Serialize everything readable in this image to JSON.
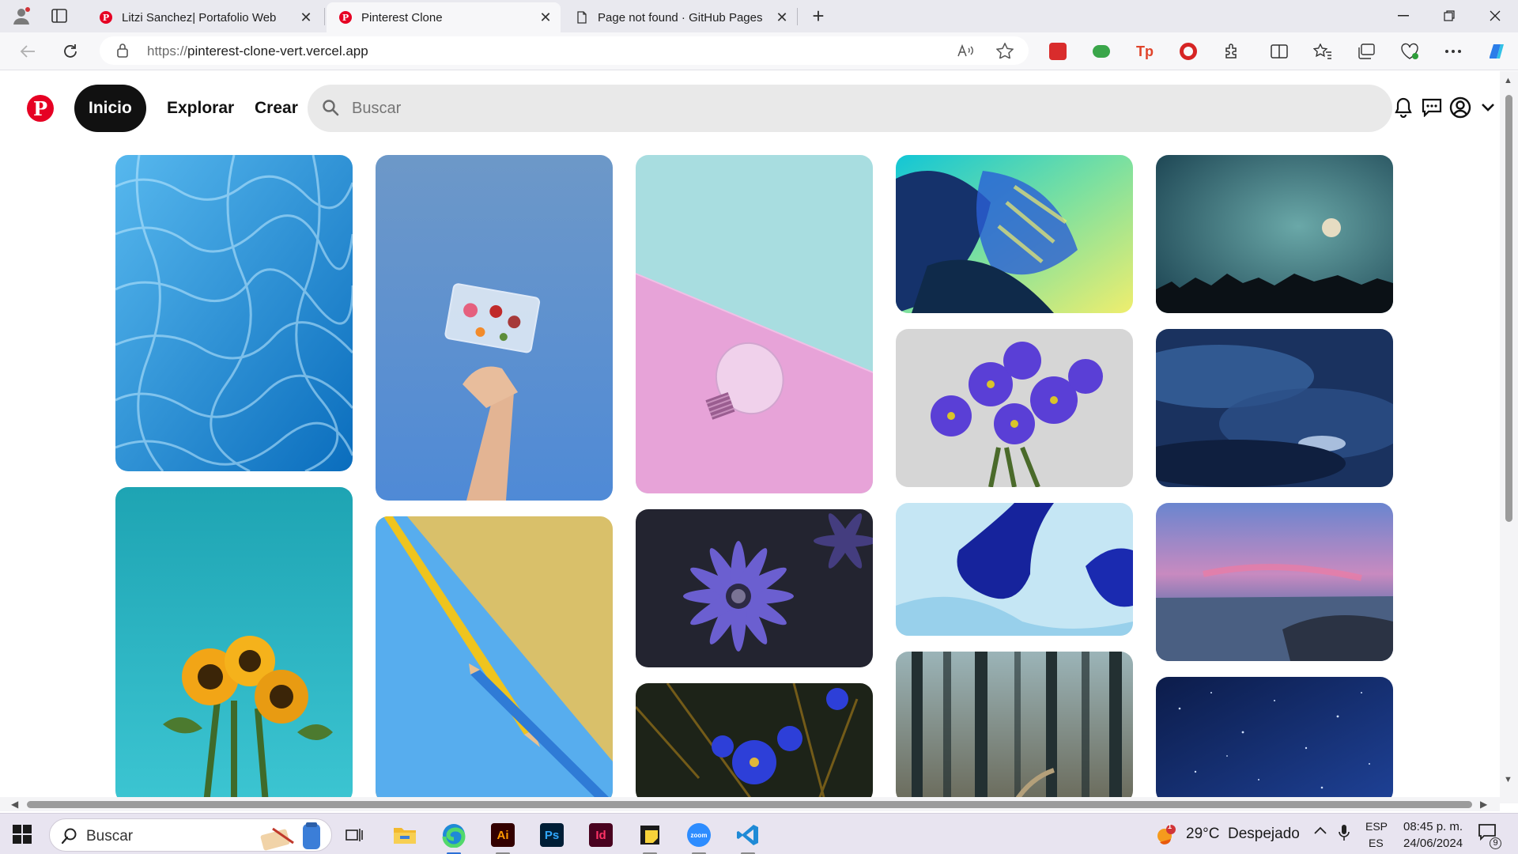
{
  "browser": {
    "tabs": [
      {
        "title": "Litzi Sanchez| Portafolio Web",
        "active": false
      },
      {
        "title": "Pinterest Clone",
        "active": true
      },
      {
        "title": "Page not found · GitHub Pages",
        "active": false
      }
    ],
    "tab_close_glyph": "✕",
    "new_tab_glyph": "+",
    "url_scheme": "https://",
    "url_host": "pinterest-clone-vert.vercel.app"
  },
  "header": {
    "logo_letter": "P",
    "nav": {
      "home": "Inicio",
      "explore": "Explorar",
      "create": "Crear"
    },
    "search_placeholder": "Buscar"
  },
  "pins": [
    {
      "desc": "swimming pool water",
      "colors": [
        "#3fa8e6",
        "#0b74c4"
      ]
    },
    {
      "desc": "sunflowers on teal",
      "colors": [
        "#2fb3c1",
        "#1a9fb0"
      ]
    },
    {
      "desc": "hand holding cassette",
      "colors": [
        "#6f9ccf",
        "#5b8fd0"
      ]
    },
    {
      "desc": "pencils on yellow and blue",
      "colors": [
        "#d9c06a",
        "#55aef0"
      ]
    },
    {
      "desc": "light bulb pink and teal",
      "colors": [
        "#a8dde0",
        "#e7a2d6"
      ]
    },
    {
      "desc": "purple daisy",
      "colors": [
        "#2a2a38",
        "#6a5fc7"
      ]
    },
    {
      "desc": "blue flowers dark",
      "colors": [
        "#1f2a1f",
        "#2d3fd8"
      ]
    },
    {
      "desc": "monstera leaves neon",
      "colors": [
        "#25bfc9",
        "#e4ea6b"
      ]
    },
    {
      "desc": "purple flower bouquet",
      "colors": [
        "#d9d9d9",
        "#5b3fd3"
      ]
    },
    {
      "desc": "blue ink in water",
      "colors": [
        "#bfe4f2",
        "#17259c"
      ]
    },
    {
      "desc": "misty forest",
      "colors": [
        "#8aa4aa",
        "#2e3b3c"
      ]
    },
    {
      "desc": "moon over treeline",
      "colors": [
        "#3f8b96",
        "#0d1a22"
      ]
    },
    {
      "desc": "stormy blue clouds",
      "colors": [
        "#2e4f8a",
        "#0f1f3f"
      ]
    },
    {
      "desc": "pink sunset over sea",
      "colors": [
        "#7d8bd0",
        "#3a4d6a"
      ]
    },
    {
      "desc": "starry night sky",
      "colors": [
        "#16327a",
        "#081a4a"
      ]
    }
  ],
  "taskbar": {
    "search_placeholder": "Buscar",
    "weather": "29°C  Despejado",
    "weather_badge": "1",
    "lang_top": "ESP",
    "lang_bottom": "ES",
    "time": "08:45 p. m.",
    "date": "24/06/2024",
    "notif_count": "9",
    "apps": [
      "Ai",
      "Ps",
      "Id"
    ]
  }
}
